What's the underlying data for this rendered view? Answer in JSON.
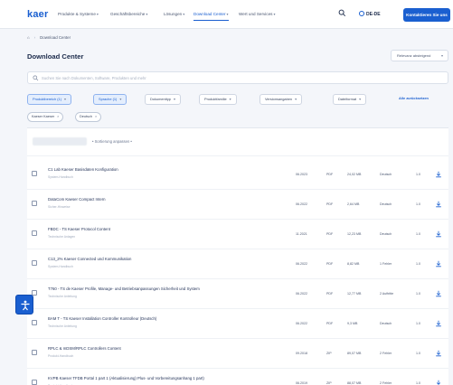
{
  "brand": {
    "logo": "kaer",
    "accent": "#1a5fd0"
  },
  "nav": {
    "items": [
      {
        "label": "Produkte & Systeme"
      },
      {
        "label": "Geschäftsbereiche"
      },
      {
        "label": "Lösungen"
      },
      {
        "label": "Download Center"
      },
      {
        "label": "Wert und Services"
      }
    ],
    "language": "DE-DE",
    "cta": "Kontaktieren Sie uns"
  },
  "breadcrumb": {
    "current": "Download Center"
  },
  "page": {
    "title": "Download Center",
    "sort_label": "Relevanz absteigend"
  },
  "search": {
    "placeholder": "Suchen Sie nach Dokumenten, Software, Produkten und mehr"
  },
  "filters": [
    {
      "label": "Produktbereich (1)"
    },
    {
      "label": "Sprache (1)"
    },
    {
      "label": "Dokumenttyp"
    },
    {
      "label": "Produktfamilie"
    },
    {
      "label": "Versionsangaben"
    },
    {
      "label": "Dateiformat"
    },
    {
      "label": "Alle zurücksetzen"
    }
  ],
  "chips": [
    {
      "label": "Kaeser Kaeser"
    },
    {
      "label": "Deutsch"
    }
  ],
  "results": {
    "summary": "• Sortierung anpassen •"
  },
  "rows": [
    {
      "title": "C1 Lab Kaeser Basisdaten Konfiguration",
      "sub": "System-Handbuch",
      "date": "06.2023",
      "type": "PDF",
      "size": "24,02 MB",
      "lang": "Deutsch",
      "ver": "1.0"
    },
    {
      "title": "DataCom Kaeser Compact Intern",
      "sub": "Sicher-Hinweise",
      "date": "06.2022",
      "type": "PDF",
      "size": "2,64 MB",
      "lang": "Deutsch",
      "ver": "1.0"
    },
    {
      "title": "FBDC - TS Kaeser Protocol Content",
      "sub": "Technische Anlagen",
      "date": "11.2021",
      "type": "PDF",
      "size": "12,23 MB",
      "lang": "Deutsch",
      "ver": "1.0"
    },
    {
      "title": "C13_2% Kaeser Connected und Kommunikation",
      "sub": "System-Handbuch",
      "date": "06.2022",
      "type": "PDF",
      "size": "8,82 MB",
      "lang": "1 Fehler",
      "ver": "1.0"
    },
    {
      "title": "T760 - TS de Kaeser Profile, Manage- und Betriebsanpassungen Sicherheit und System",
      "sub": "Technische Anleitung",
      "date": "06.2022",
      "type": "PDF",
      "size": "12,77 MB",
      "lang": "2 Auftritte",
      "ver": "1.0"
    },
    {
      "title": "BAM T - TS Kaeser Installation Controller Kontrolleur (Deutsch)",
      "sub": "Technische Anleitung",
      "date": "06.2022",
      "type": "PDF",
      "size": "9,3 MB",
      "lang": "Deutsch",
      "ver": "1.0"
    },
    {
      "title": "RPLC & mDSM/RPLC Controllers Content",
      "sub": "Produkt-Handbuch",
      "date": "09.2018",
      "type": "ZIP",
      "size": "89,07 MB",
      "lang": "2 Fehler",
      "ver": "1.0"
    },
    {
      "title": "KVPB Kaeser TFDB Portal 1 part 1 (Aktualisierung) Plus- und Vorbereitungsanhang 1 part)",
      "sub": "Produkt-Handbuch",
      "date": "06.2019",
      "type": "ZIP",
      "size": "88,07 MB",
      "lang": "2 Fehler",
      "ver": "1.0"
    }
  ]
}
